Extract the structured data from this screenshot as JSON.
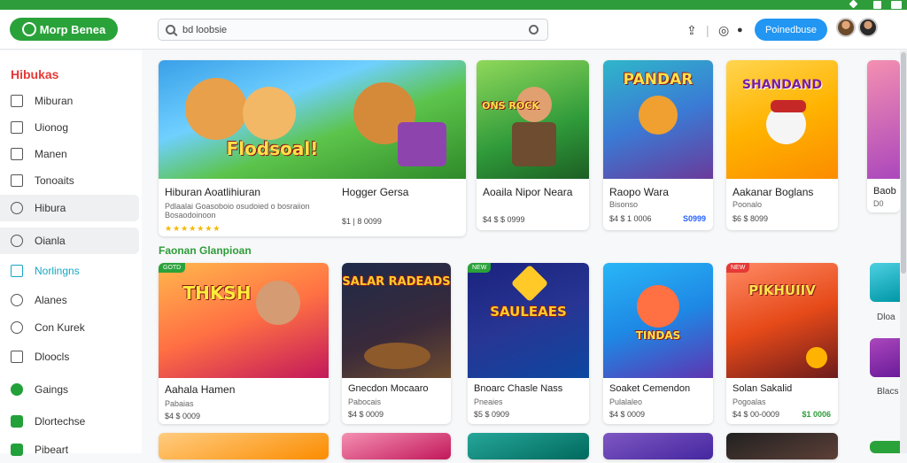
{
  "header": {
    "logo_text": "Morp Benea",
    "search_value": "bd loobsie",
    "signin_label": "Poinedbuse"
  },
  "sidebar": {
    "title": "Hibukas",
    "items": [
      {
        "label": "Miburan",
        "icon": "edit-icon"
      },
      {
        "label": "Uionog",
        "icon": "square-icon"
      },
      {
        "label": "Manen",
        "icon": "phone-icon"
      },
      {
        "label": "Tonoaits",
        "icon": "calendar-icon"
      },
      {
        "label": "Hibura",
        "icon": "globe-icon"
      },
      {
        "label": "Oianla",
        "icon": "chat-icon"
      },
      {
        "label": "Norlingns",
        "icon": "tv-icon"
      },
      {
        "label": "Alanes",
        "icon": "tag-icon"
      },
      {
        "label": "Con Kurek",
        "icon": "puzzle-icon"
      },
      {
        "label": "Dloocls",
        "icon": "list-icon"
      },
      {
        "label": "Gaings",
        "icon": "play-circle-icon"
      },
      {
        "label": "Dlortechse",
        "icon": "store-icon"
      },
      {
        "label": "Pibeart",
        "icon": "box-icon"
      }
    ]
  },
  "row1": [
    {
      "title": "Hiburan Aoatlihiuran",
      "sub": "Pdlaalai Goasoboio osudoied o bosraiion",
      "sub2": "Bosaodoinoon",
      "meta": "",
      "price": "",
      "stars": "★★★★★★★",
      "word": "Flodsoal!",
      "accent": "#4caf50"
    },
    {
      "title": "Hogger Gersa",
      "sub": "",
      "sub2": "",
      "meta": "$1 | 8 0099",
      "price": "",
      "stars": "",
      "word": "",
      "accent": "#e91e63"
    },
    {
      "title": "Aoaila Nipor Neara",
      "sub": "",
      "sub2": "",
      "meta": "$4  $ $ 0999",
      "price": "",
      "stars": "",
      "word": "ONS ROCK",
      "accent": "#3f8a2a"
    },
    {
      "title": "Raopo Wara",
      "sub": "Bisonso",
      "sub2": "",
      "meta": "$4  $ 1 0006",
      "price": "S0999",
      "priceColor": "#2962ff",
      "stars": "",
      "word": "PANDAR",
      "accent": "#d32f2f"
    },
    {
      "title": "Aakanar Boglans",
      "sub": "Poonalo",
      "sub2": "",
      "meta": "$6  $ 8099",
      "price": "",
      "stars": "",
      "word": "SHANDAND",
      "accent": "#ff9800"
    },
    {
      "title": "Baob",
      "sub": "D0",
      "sub2": "",
      "meta": "",
      "price": "",
      "stars": "",
      "word": "",
      "accent": "#9c27b0"
    }
  ],
  "section_title": "Faonan Glanpioan",
  "row2": [
    {
      "title": "Aahala Hamen",
      "sub": "Pabaias",
      "meta": "$4  $ 0009",
      "price": "",
      "badge": "GOTD",
      "word": "THKSH",
      "accent": "#ff5722"
    },
    {
      "title": "Gnecdon Mocaaro",
      "sub": "Pabocais",
      "meta": "$4  $ 0009",
      "price": "",
      "badge": "",
      "word": "SALAR RADEADS",
      "accent": "#8d6e63"
    },
    {
      "title": "Bnoarc Chasle Nass",
      "sub": "Pneaies",
      "meta": "$5  $ 0909",
      "price": "",
      "badge": "NEW",
      "word": "SAULEAES",
      "accent": "#3949ab"
    },
    {
      "title": "Soaket Cemendon",
      "sub": "Pulalaleo",
      "meta": "$4  $ 0009",
      "price": "",
      "badge": "",
      "word": "TINDAS",
      "accent": "#ff7043"
    },
    {
      "title": "Solan Sakalid",
      "sub": "Pogoalas",
      "meta": "$4  $ 00-0009",
      "price": "$1 0006",
      "priceColor": "#2e9c3a",
      "badge": "NEW",
      "word": "PIKHUIIV",
      "accent": "#e64a19"
    }
  ],
  "right_peek": [
    {
      "label": "Dloa"
    },
    {
      "label": "Blacs"
    }
  ]
}
